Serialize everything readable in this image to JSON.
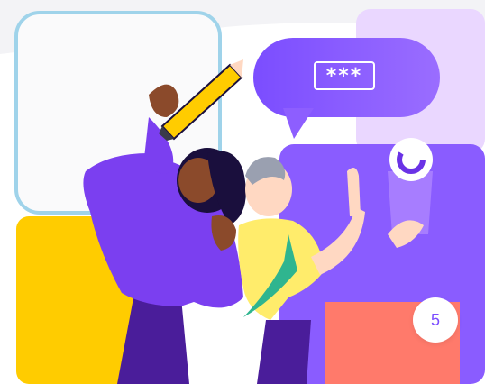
{
  "illustration": {
    "password_mask": "***",
    "step_number": "5",
    "colors": {
      "purple": "#8a5cff",
      "dark_purple": "#6a32e6",
      "yellow": "#ffcc00",
      "coral": "#ff7a6b",
      "lavender": "#e6d5ff",
      "frame_border": "#9fd3ea",
      "skin_dark": "#8b4a2b",
      "skin_light": "#ffd8c2",
      "shirt_yellow": "#ffec6b",
      "tie_green": "#2fb58f"
    },
    "icons": [
      "pencil-icon",
      "loading-ring-icon"
    ]
  }
}
